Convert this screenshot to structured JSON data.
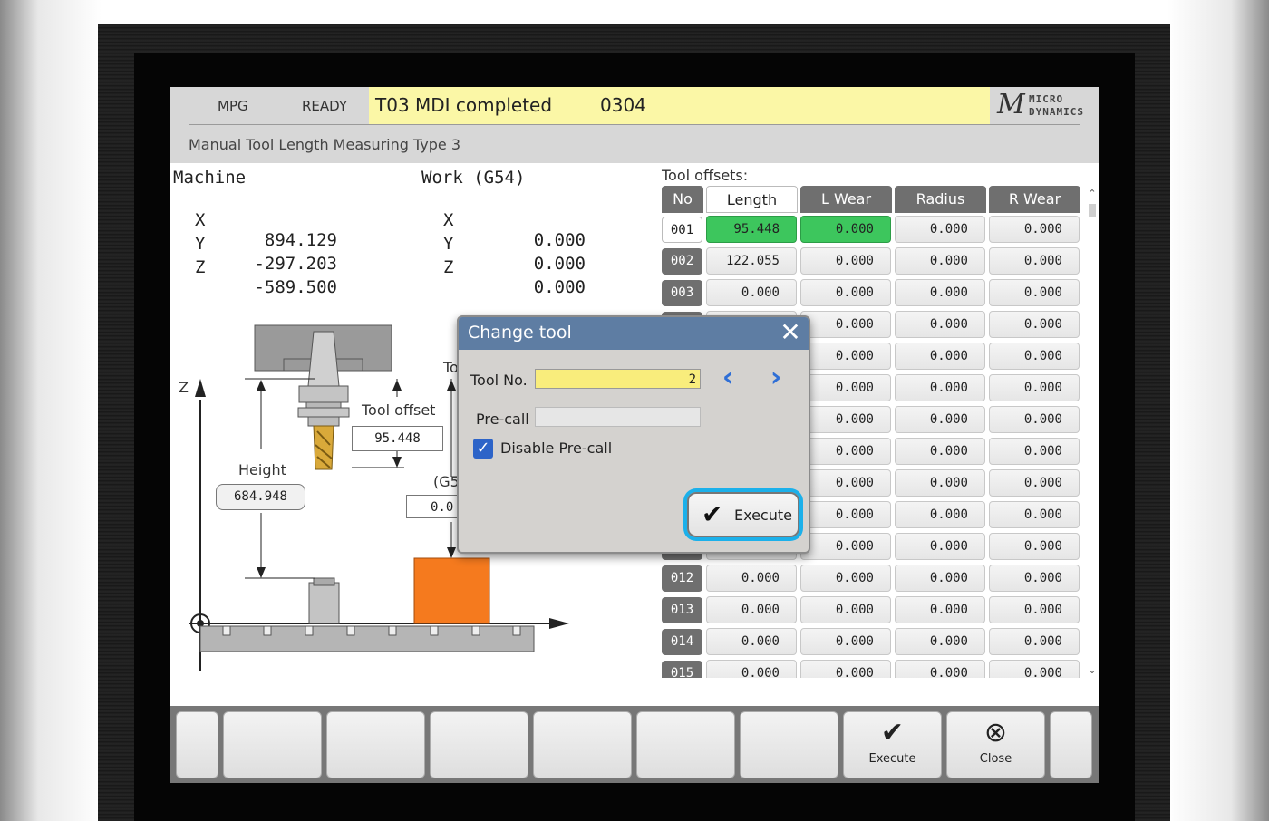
{
  "status": {
    "mode": "MPG",
    "state": "READY",
    "message": "T03  MDI completed",
    "program": "0304",
    "logo_mark": "M",
    "logo_text_1": "MICRO",
    "logo_text_2": "DYNAMICS"
  },
  "page_title": "Manual Tool Length Measuring Type 3",
  "machine": {
    "title": "Machine",
    "axes": [
      {
        "axis": "X",
        "value": "894.129"
      },
      {
        "axis": "Y",
        "value": "-297.203"
      },
      {
        "axis": "Z",
        "value": "-589.500"
      }
    ]
  },
  "work": {
    "title": "Work (G54)",
    "axes": [
      {
        "axis": "X",
        "value": "0.000"
      },
      {
        "axis": "Y",
        "value": "0.000"
      },
      {
        "axis": "Z",
        "value": "0.000"
      }
    ]
  },
  "diagram": {
    "z_label": "Z",
    "tool_offset_label": "Tool offset",
    "tool_offset_value": "95.448",
    "height_label": "Height",
    "height_value": "684.948",
    "work_label_partial": "(G5",
    "work_value_partial": "0.0",
    "top_label_partial": "To"
  },
  "tool_offsets": {
    "title": "Tool offsets:",
    "columns": [
      "No",
      "Length",
      "L Wear",
      "Radius",
      "R Wear"
    ],
    "rows": [
      {
        "no": "001",
        "length": "95.448",
        "lwear": "0.000",
        "radius": "0.000",
        "rwear": "0.000"
      },
      {
        "no": "002",
        "length": "122.055",
        "lwear": "0.000",
        "radius": "0.000",
        "rwear": "0.000"
      },
      {
        "no": "003",
        "length": "0.000",
        "lwear": "0.000",
        "radius": "0.000",
        "rwear": "0.000"
      },
      {
        "no": "",
        "length": "",
        "lwear": "0.000",
        "radius": "0.000",
        "rwear": "0.000"
      },
      {
        "no": "",
        "length": "",
        "lwear": "0.000",
        "radius": "0.000",
        "rwear": "0.000"
      },
      {
        "no": "",
        "length": "",
        "lwear": "0.000",
        "radius": "0.000",
        "rwear": "0.000"
      },
      {
        "no": "",
        "length": "",
        "lwear": "0.000",
        "radius": "0.000",
        "rwear": "0.000"
      },
      {
        "no": "",
        "length": "",
        "lwear": "0.000",
        "radius": "0.000",
        "rwear": "0.000"
      },
      {
        "no": "",
        "length": "",
        "lwear": "0.000",
        "radius": "0.000",
        "rwear": "0.000"
      },
      {
        "no": "",
        "length": "",
        "lwear": "0.000",
        "radius": "0.000",
        "rwear": "0.000"
      },
      {
        "no": "",
        "length": "",
        "lwear": "0.000",
        "radius": "0.000",
        "rwear": "0.000"
      },
      {
        "no": "012",
        "length": "0.000",
        "lwear": "0.000",
        "radius": "0.000",
        "rwear": "0.000"
      },
      {
        "no": "013",
        "length": "0.000",
        "lwear": "0.000",
        "radius": "0.000",
        "rwear": "0.000"
      },
      {
        "no": "014",
        "length": "0.000",
        "lwear": "0.000",
        "radius": "0.000",
        "rwear": "0.000"
      },
      {
        "no": "015",
        "length": "0.000",
        "lwear": "0.000",
        "radius": "0.000",
        "rwear": "0.000"
      }
    ]
  },
  "dialog": {
    "title": "Change tool",
    "tool_no_label": "Tool No.",
    "tool_no_value": "2",
    "precall_label": "Pre-call",
    "precall_value": "",
    "disable_precall_label": "Disable Pre-call",
    "disable_precall_checked": true,
    "execute_label": "Execute",
    "icons": [
      "close-icon",
      "chevron-left-icon",
      "chevron-right-icon",
      "checkmark-icon"
    ]
  },
  "softkeys": {
    "execute_label": "Execute",
    "close_label": "Close"
  },
  "colors": {
    "message_bg": "#fbf7a6",
    "selected_cell": "#3dc65d",
    "dialog_title": "#5e7da3",
    "highlight": "#1bb0ea",
    "workpiece": "#f57a1e",
    "tool_no_field": "#f9ed7c"
  }
}
